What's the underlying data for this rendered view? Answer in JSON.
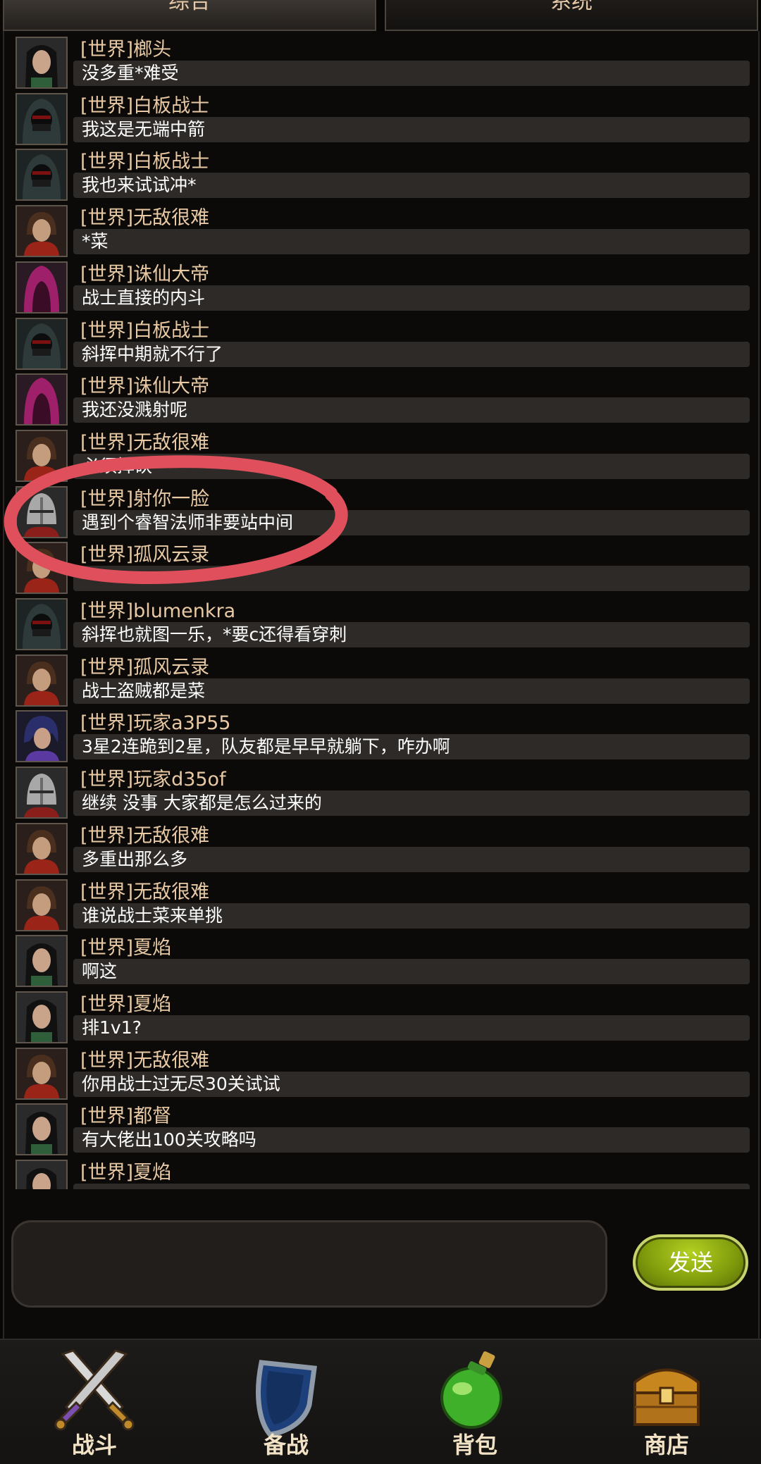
{
  "tabs": {
    "left": "综合",
    "right": "系统"
  },
  "messages": [
    {
      "name": "[世界]榔头",
      "text": "没多重*难受",
      "avatar": "dark-hair-female"
    },
    {
      "name": "[世界]白板战士",
      "text": "我这是无端中箭",
      "avatar": "hooded-assassin"
    },
    {
      "name": "[世界]白板战士",
      "text": "我也来试试冲*",
      "avatar": "hooded-assassin"
    },
    {
      "name": "[世界]无敌很难",
      "text": "*菜",
      "avatar": "red-scarf-warrior"
    },
    {
      "name": "[世界]诛仙大帝",
      "text": "战士直接的内斗",
      "avatar": "magenta-hooded"
    },
    {
      "name": "[世界]白板战士",
      "text": "斜挥中期就不行了",
      "avatar": "hooded-assassin"
    },
    {
      "name": "[世界]诛仙大帝",
      "text": "我还没溅射呢",
      "avatar": "magenta-hooded"
    },
    {
      "name": "[世界]无敌很难",
      "text": "必须挥砍",
      "avatar": "red-scarf-warrior"
    },
    {
      "name": "[世界]射你一脸",
      "text": "遇到个睿智法师非要站中间",
      "avatar": "helmet-knight"
    },
    {
      "name": "[世界]孤风云录",
      "text": "",
      "avatar": "red-scarf-warrior"
    },
    {
      "name": "[世界]blumenkra",
      "text": "斜挥也就图一乐，*要c还得看穿刺",
      "avatar": "hooded-assassin"
    },
    {
      "name": "[世界]孤风云录",
      "text": "战士盗贼都是菜",
      "avatar": "red-scarf-warrior"
    },
    {
      "name": "[世界]玩家a3P55",
      "text": "3星2连跪到2星，队友都是早早就躺下，咋办啊",
      "avatar": "blue-hair-rogue"
    },
    {
      "name": "[世界]玩家d35of",
      "text": "继续 没事  大家都是怎么过来的",
      "avatar": "helmet-knight"
    },
    {
      "name": "[世界]无敌很难",
      "text": "多重出那么多",
      "avatar": "red-scarf-warrior"
    },
    {
      "name": "[世界]无敌很难",
      "text": "谁说战士菜来单挑",
      "avatar": "red-scarf-warrior"
    },
    {
      "name": "[世界]夏焰",
      "text": "啊这",
      "avatar": "dark-hair-female"
    },
    {
      "name": "[世界]夏焰",
      "text": "排1v1?",
      "avatar": "dark-hair-female"
    },
    {
      "name": "[世界]无敌很难",
      "text": "你用战士过无尽30关试试",
      "avatar": "red-scarf-warrior"
    },
    {
      "name": "[世界]都督",
      "text": "有大佬出100关攻略吗",
      "avatar": "dark-hair-female"
    },
    {
      "name": "[世界]夏焰",
      "text": "",
      "avatar": "dark-hair-female"
    }
  ],
  "input": {
    "value": "",
    "placeholder": ""
  },
  "send_button": "发送",
  "nav": [
    {
      "label": "战斗",
      "icon": "crossed-swords-icon"
    },
    {
      "label": "备战",
      "icon": "shield-icon"
    },
    {
      "label": "背包",
      "icon": "potion-icon"
    },
    {
      "label": "商店",
      "icon": "treasure-chest-icon"
    }
  ],
  "colors": {
    "name_text": "#e8c9a4",
    "bubble": "#2e2a27",
    "send_button": "#8fae10",
    "annotation": "#e0505c"
  }
}
